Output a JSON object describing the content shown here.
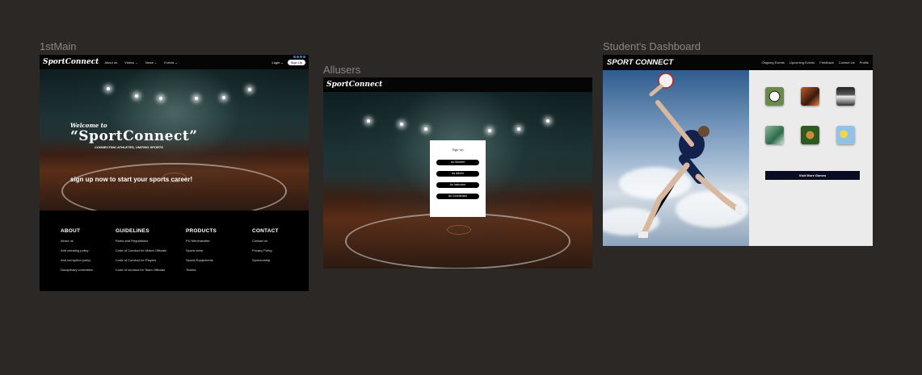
{
  "frames": {
    "main": {
      "label": "1stMain",
      "nav": {
        "brand": "SportConnect",
        "links": [
          "About us",
          "Videos ⌄",
          "News ⌄",
          "Events ⌄"
        ],
        "login": "Login ⌄",
        "signup": "Sign Up"
      },
      "hero": {
        "welcome": "Welcome to",
        "title": "“SportConnect”",
        "tagline": "CONNECTING ATHLETES, UNITING SPORTS",
        "cta": "sign up now to start your sports career!"
      },
      "footer": {
        "about": {
          "heading": "ABOUT",
          "items": [
            "About us",
            "Anti cheating policy",
            "Anti corruption policy",
            "Disciplinary committee"
          ]
        },
        "guidelines": {
          "heading": "GUIDELINES",
          "items": [
            "Rules and Regulations",
            "Code of Conduct for Match Officials",
            "Code of Conduct for Players",
            "Code of conduct for Team Officials"
          ]
        },
        "products": {
          "heading": "PRODUCTS",
          "items": [
            "PU Merchandise",
            "Sports wear",
            "Sports Equipments",
            "Tickets"
          ]
        },
        "contact": {
          "heading": "CONTACT",
          "items": [
            "Contact us",
            "Privacy Policy",
            "Sponsorship"
          ]
        }
      }
    },
    "allusers": {
      "label": "Allusers",
      "brand": "SportConnect",
      "modal": {
        "title": "Sign Up",
        "buttons": [
          "As Student",
          "As Admin",
          "As Instructor",
          "As Coordinator"
        ]
      }
    },
    "dashboard": {
      "label": "Student's Dashboard",
      "nav": {
        "brand": "SPORT CONNECT",
        "links": [
          "Ongoing Events",
          "Upcoming Events",
          "Feedback",
          "Contact Us",
          "Profile"
        ]
      },
      "visit_button": "Visit More Games"
    }
  },
  "colors": {
    "canvas": "#2c2826",
    "frame_label": "#8a8683",
    "panel": "#ebebeb",
    "visit_button": "#0b0b22"
  }
}
